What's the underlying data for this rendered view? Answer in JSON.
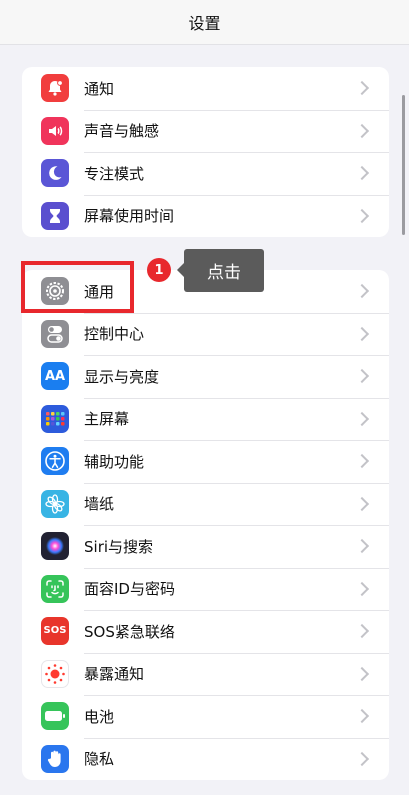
{
  "nav": {
    "title": "设置"
  },
  "group1": [
    {
      "id": "notifications",
      "label": "通知",
      "icon": "bell-icon",
      "color": "#f13d3d"
    },
    {
      "id": "sounds",
      "label": "声音与触感",
      "icon": "speaker-icon",
      "color": "#f0345b"
    },
    {
      "id": "focus",
      "label": "专注模式",
      "icon": "moon-icon",
      "color": "#5a56d6"
    },
    {
      "id": "screen-time",
      "label": "屏幕使用时间",
      "icon": "hourglass-icon",
      "color": "#5a4fcf"
    }
  ],
  "group2": [
    {
      "id": "general",
      "label": "通用",
      "icon": "gear-icon",
      "color": "#8e8e93"
    },
    {
      "id": "control-center",
      "label": "控制中心",
      "icon": "toggle-icon",
      "color": "#8e8e93"
    },
    {
      "id": "display",
      "label": "显示与亮度",
      "icon": "aa-icon",
      "glyph": "AA",
      "color": "#1a7ef0"
    },
    {
      "id": "home-screen",
      "label": "主屏幕",
      "icon": "app-grid-icon",
      "color": "#2d5bdc"
    },
    {
      "id": "accessibility",
      "label": "辅助功能",
      "icon": "accessibility-icon",
      "color": "#1f7df0"
    },
    {
      "id": "wallpaper",
      "label": "墙纸",
      "icon": "flower-icon",
      "color": "#38b4e4"
    },
    {
      "id": "siri",
      "label": "Siri与搜索",
      "icon": "siri-icon",
      "color": "#222233"
    },
    {
      "id": "face-id",
      "label": "面容ID与密码",
      "icon": "face-id-icon",
      "color": "#36c45a"
    },
    {
      "id": "sos",
      "label": "SOS紧急联络",
      "icon": "sos-icon",
      "glyph": "SOS",
      "color": "#e8352b"
    },
    {
      "id": "exposure",
      "label": "暴露通知",
      "icon": "exposure-icon",
      "color": "#ffffff"
    },
    {
      "id": "battery",
      "label": "电池",
      "icon": "battery-icon",
      "color": "#36c45a"
    },
    {
      "id": "privacy",
      "label": "隐私",
      "icon": "hand-icon",
      "color": "#2a76ee"
    }
  ],
  "annotation": {
    "step": "1",
    "tooltip": "点击"
  }
}
